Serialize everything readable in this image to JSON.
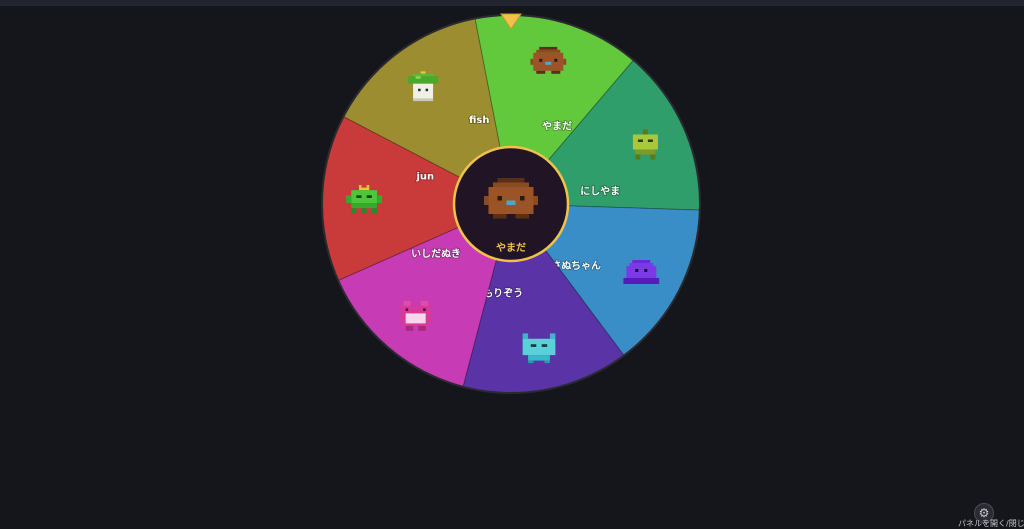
{
  "wheel": {
    "segments": [
      {
        "label": "やまだ",
        "color": "#62c93c",
        "character": "brown-blob"
      },
      {
        "label": "にしやま",
        "color": "#2f9e6a",
        "character": "green-robot"
      },
      {
        "label": "さぬちゃん",
        "color": "#3a8ec8",
        "character": "purple-slime"
      },
      {
        "label": "もりぞう",
        "color": "#5a34a6",
        "character": "cyan-cat"
      },
      {
        "label": "いしだぬき",
        "color": "#c73bb4",
        "character": "pink-frog"
      },
      {
        "label": "jun",
        "color": "#c93a3a",
        "character": "green-invader"
      },
      {
        "label": "fish",
        "color": "#9c8e30",
        "character": "mushroom"
      }
    ],
    "selected": {
      "label": "やまだ",
      "character": "brown-blob"
    },
    "pointer_color": "#f0c24a"
  },
  "panel_toggle": {
    "label": "パネルを開く/閉じる",
    "icon": "gear-icon"
  }
}
